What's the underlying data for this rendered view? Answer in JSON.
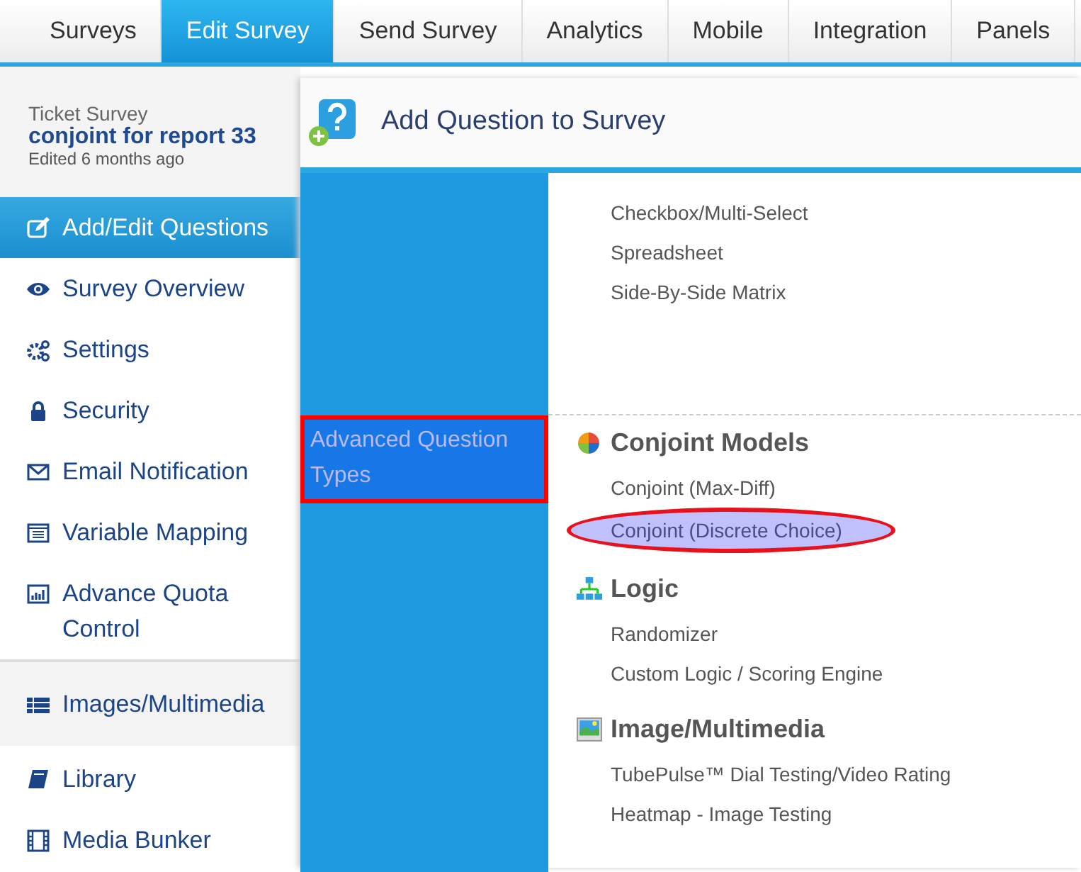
{
  "tabs": [
    {
      "label": "Surveys",
      "selected": false
    },
    {
      "label": "Edit Survey",
      "selected": true
    },
    {
      "label": "Send Survey",
      "selected": false
    },
    {
      "label": "Analytics",
      "selected": false
    },
    {
      "label": "Mobile",
      "selected": false
    },
    {
      "label": "Integration",
      "selected": false
    },
    {
      "label": "Panels",
      "selected": false
    }
  ],
  "survey": {
    "type": "Ticket Survey",
    "name": "conjoint for report 33",
    "edited": "Edited 6 months ago"
  },
  "sidebar": {
    "items": [
      {
        "label": "Add/Edit Questions",
        "kind": "item",
        "selected": true
      },
      {
        "label": "Survey Overview",
        "kind": "item",
        "selected": false
      },
      {
        "label": "Settings",
        "kind": "item",
        "selected": false
      },
      {
        "label": "Security",
        "kind": "item",
        "selected": false
      },
      {
        "label": "Email Notification",
        "kind": "item",
        "selected": false
      },
      {
        "label": "Variable Mapping",
        "kind": "item",
        "selected": false
      },
      {
        "label": "Advance Quota Control",
        "kind": "item",
        "selected": false
      },
      {
        "label": "Images/Multimedia",
        "kind": "section",
        "selected": false
      },
      {
        "label": "Library",
        "kind": "item",
        "selected": false
      },
      {
        "label": "Media Bunker",
        "kind": "item",
        "selected": false
      }
    ]
  },
  "panel": {
    "title": "Add Question to Survey",
    "categories": [
      {
        "label": "Advanced Question Types",
        "selected": true
      }
    ],
    "groups": [
      {
        "items": [
          {
            "label": "Checkbox/Multi-Select",
            "highlighted": false
          },
          {
            "label": "Spreadsheet",
            "highlighted": false
          },
          {
            "label": "Side-By-Side Matrix",
            "highlighted": false
          }
        ]
      },
      {
        "title": "Conjoint Models",
        "items": [
          {
            "label": "Conjoint (Max-Diff)",
            "highlighted": false
          },
          {
            "label": "Conjoint (Discrete Choice)",
            "highlighted": true
          }
        ]
      },
      {
        "title": "Logic",
        "items": [
          {
            "label": "Randomizer",
            "highlighted": false
          },
          {
            "label": "Custom Logic / Scoring Engine",
            "highlighted": false
          }
        ]
      },
      {
        "title": "Image/Multimedia",
        "items": [
          {
            "label": "TubePulse™ Dial Testing/Video Rating",
            "highlighted": false
          },
          {
            "label": "Heatmap - Image Testing",
            "highlighted": false
          }
        ]
      }
    ]
  }
}
